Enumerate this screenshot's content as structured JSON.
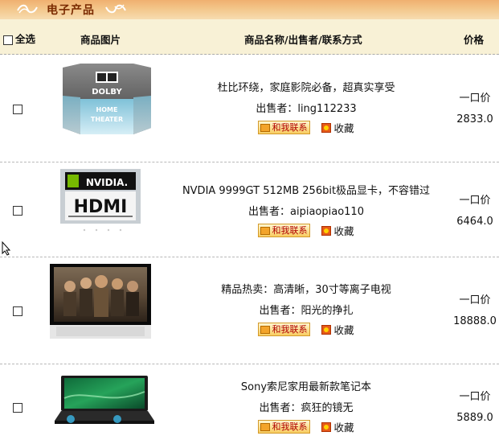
{
  "section": {
    "title": "电子产品"
  },
  "header": {
    "select_all": "全选",
    "image": "商品图片",
    "name": "商品名称/出售者/联系方式",
    "price": "价格"
  },
  "products": [
    {
      "name": "杜比环绕，家庭影院必备，超真实享受",
      "seller": "出售者：ling112233",
      "contact": "和我联系",
      "favorite": "收藏",
      "price_type": "一口价",
      "price": "2833.0",
      "image_icon": "dolby-home-theater-image",
      "image_text": [
        "DOLBY",
        "HOME",
        "THEATER"
      ]
    },
    {
      "name": "NVDIA 9999GT 512MB 256bit极品显卡，不容错过",
      "seller": "出售者：aipiaopiao110",
      "contact": "和我联系",
      "favorite": "收藏",
      "price_type": "一口价",
      "price": "6464.0",
      "image_icon": "nvidia-hdmi-image",
      "image_text": [
        "NVIDIA.",
        "HDMI"
      ]
    },
    {
      "name": "精品热卖：高清晰，30寸等离子电视",
      "seller": "出售者：阳光的挣扎",
      "contact": "和我联系",
      "favorite": "收藏",
      "price_type": "一口价",
      "price": "18888.0",
      "image_icon": "plasma-tv-image"
    },
    {
      "name": "Sony索尼家用最新款笔记本",
      "seller": "出售者：疯狂的镜无",
      "contact": "和我联系",
      "favorite": "收藏",
      "price_type": "一口价",
      "price": "5889.0",
      "image_icon": "laptop-image"
    }
  ],
  "colors": {
    "header_bar": "#f3c68a",
    "title": "#7a2a00",
    "column_header_bg": "#f8f1d6",
    "contact_text": "#b00000"
  }
}
